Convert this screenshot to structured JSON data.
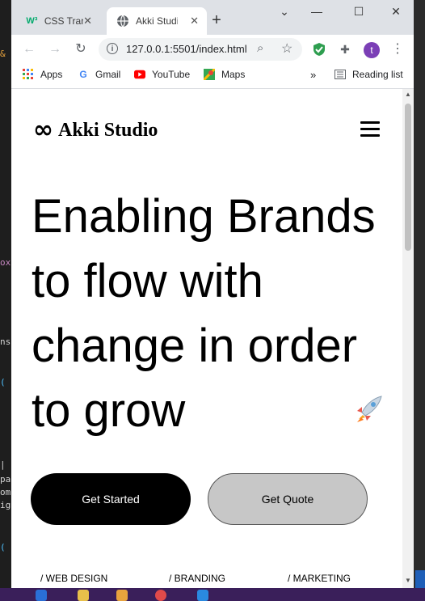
{
  "browser": {
    "tabs": [
      {
        "title": "CSS Transitions",
        "favicon": "w3-icon",
        "active": false
      },
      {
        "title": "Akki Studio",
        "favicon": "globe-icon",
        "active": true
      }
    ],
    "address": "127.0.0.1:5501/index.html",
    "bookmarks": [
      "Apps",
      "Gmail",
      "YouTube",
      "Maps"
    ],
    "reading_list": "Reading list",
    "avatar_letter": "t",
    "more_bookmarks": "»"
  },
  "page": {
    "brand_name": "Akki Studio",
    "hero_text": "Enabling Brands to flow with change in order to grow",
    "buttons": {
      "get_started": "Get Started",
      "get_quote": "Get Quote"
    },
    "services": [
      "/ WEB DESIGN",
      "/ BRANDING",
      "/ MARKETING"
    ]
  },
  "colors": {
    "tabstrip": "#dee1e6",
    "primary_button": "#000000",
    "secondary_button": "#c7c7c7",
    "avatar": "#7b3fb6"
  }
}
